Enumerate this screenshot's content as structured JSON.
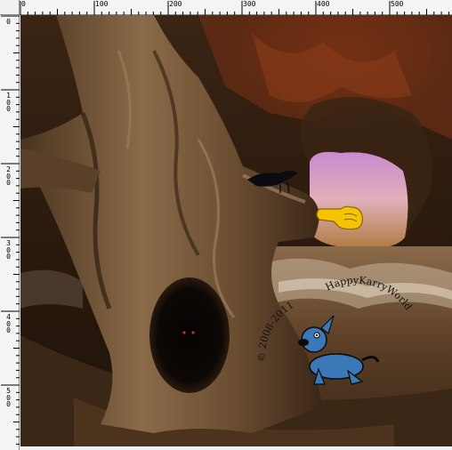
{
  "ruler": {
    "horizontal_labels": [
      {
        "text": "0",
        "value": 0
      },
      {
        "text": "100",
        "value": 100
      },
      {
        "text": "200",
        "value": 200
      },
      {
        "text": "300",
        "value": 300
      },
      {
        "text": "400",
        "value": 400
      },
      {
        "text": "500",
        "value": 500
      }
    ],
    "vertical_labels": [
      {
        "text": "0",
        "value": 0
      },
      {
        "text": "100",
        "value": 100
      },
      {
        "text": "200",
        "value": 200
      },
      {
        "text": "300",
        "value": 300
      },
      {
        "text": "400",
        "value": 400
      },
      {
        "text": "500",
        "value": 500
      }
    ]
  },
  "canvas": {
    "image_subject": "fantasy scene: giant gnarled tree trunk with dark hollow, glowing cave opening, crow, misty water",
    "watermark": {
      "text_left": "© 2008-2011",
      "text_right": "HappyKarryWorld",
      "mascot": "cartoon dog mascot"
    },
    "cursor": {
      "icon": "pointing-hand-icon",
      "color": "#f5c400"
    }
  },
  "colors": {
    "ruler_bg": "#f4f4f4",
    "canvas_dark": "#2a1a0e",
    "cave_glow": "#d9a0c8",
    "trunk": "#6b4e32"
  }
}
